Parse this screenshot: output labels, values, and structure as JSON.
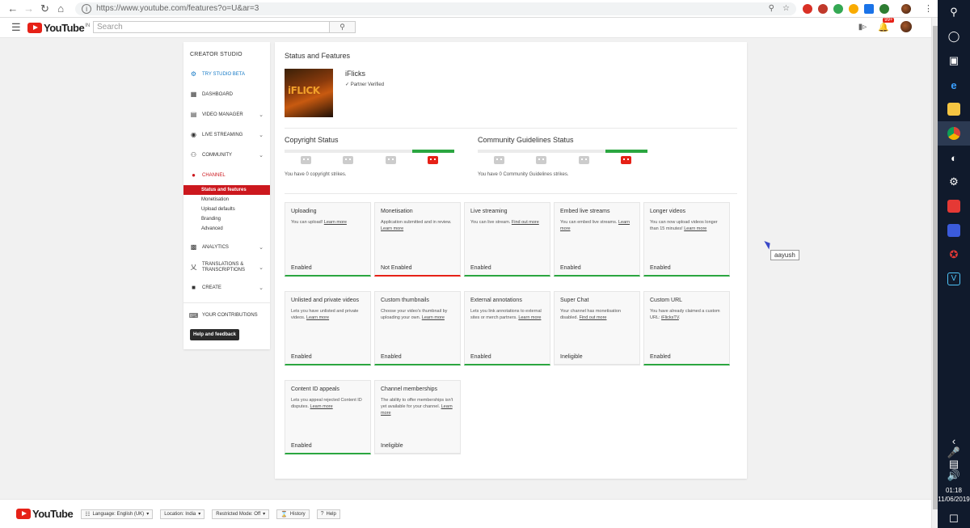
{
  "browser": {
    "url": "https://www.youtube.com/features?o=U&ar=3",
    "colors": {
      "ext1": "#d93025",
      "ext2": "#c0392b",
      "ext3": "#34a853",
      "ext4": "#f9ab00",
      "ext5": "#1a73e8",
      "ext6": "#2e7d32"
    }
  },
  "header": {
    "brand": "YouTube",
    "region": "IN",
    "search_placeholder": "Search",
    "notif_count": "99+"
  },
  "sidebar": {
    "title": "CREATOR STUDIO",
    "try_beta": "TRY STUDIO BETA",
    "dashboard": "DASHBOARD",
    "video_manager": "VIDEO MANAGER",
    "live_streaming": "LIVE STREAMING",
    "community": "COMMUNITY",
    "channel": "CHANNEL",
    "channel_sub": [
      "Status and features",
      "Monetisation",
      "Upload defaults",
      "Branding",
      "Advanced"
    ],
    "analytics": "ANALYTICS",
    "translations": "TRANSLATIONS & TRANSCRIPTIONS",
    "create": "CREATE",
    "your_contributions": "YOUR CONTRIBUTIONS",
    "help": "Help and feedback"
  },
  "main": {
    "title": "Status and Features",
    "channel_name": "iFlicks",
    "channel_logo_text": "iFLICK",
    "verified": "Partner Verified",
    "copyright": {
      "title": "Copyright Status",
      "note": "You have 0 copyright strikes."
    },
    "community": {
      "title": "Community Guidelines Status",
      "note": "You have 0 Community Guidelines strikes."
    },
    "cards": [
      {
        "title": "Uploading",
        "desc": "You can upload!",
        "link": "Learn more",
        "status": "Enabled",
        "state": "ok"
      },
      {
        "title": "Monetisation",
        "desc": "Application submitted and in review.",
        "link": "Learn more",
        "status": "Not Enabled",
        "state": "bad"
      },
      {
        "title": "Live streaming",
        "desc": "You can live stream.",
        "link": "Find out more",
        "status": "Enabled",
        "state": "ok"
      },
      {
        "title": "Embed live streams",
        "desc": "You can embed live streams.",
        "link": "Learn more",
        "status": "Enabled",
        "state": "ok"
      },
      {
        "title": "Longer videos",
        "desc": "You can now upload videos longer than 15 minutes!",
        "link": "Learn more",
        "status": "Enabled",
        "state": "ok"
      },
      {
        "title": "Unlisted and private videos",
        "desc": "Lets you have unlisted and private videos.",
        "link": "Learn more",
        "status": "Enabled",
        "state": "ok"
      },
      {
        "title": "Custom thumbnails",
        "desc": "Choose your video's thumbnail by uploading your own.",
        "link": "Learn more",
        "status": "Enabled",
        "state": "ok"
      },
      {
        "title": "External annotations",
        "desc": "Lets you link annotations to external sites or merch partners.",
        "link": "Learn more",
        "status": "Enabled",
        "state": "ok"
      },
      {
        "title": "Super Chat",
        "desc": "Your channel has monetisation disabled.",
        "link": "Find out more",
        "status": "Ineligible",
        "state": "neutral"
      },
      {
        "title": "Custom URL",
        "desc": "You have already claimed a custom URL:",
        "link": "iFlicksTV",
        "status": "Enabled",
        "state": "ok"
      },
      {
        "title": "Content ID appeals",
        "desc": "Lets you appeal rejected Content ID disputes.",
        "link": "Learn more",
        "status": "Enabled",
        "state": "ok"
      },
      {
        "title": "Channel memberships",
        "desc": "The ability to offer memberships isn't yet available for your channel.",
        "link": "Learn more",
        "status": "Ineligible",
        "state": "neutral"
      }
    ]
  },
  "tooltip": "aayush",
  "footer": {
    "language": "Language: English (UK)",
    "location": "Location: India",
    "restricted": "Restricted Mode: Off",
    "history": "History",
    "help": "Help"
  },
  "taskbar": {
    "time": "01:18",
    "date": "11/06/2019"
  }
}
